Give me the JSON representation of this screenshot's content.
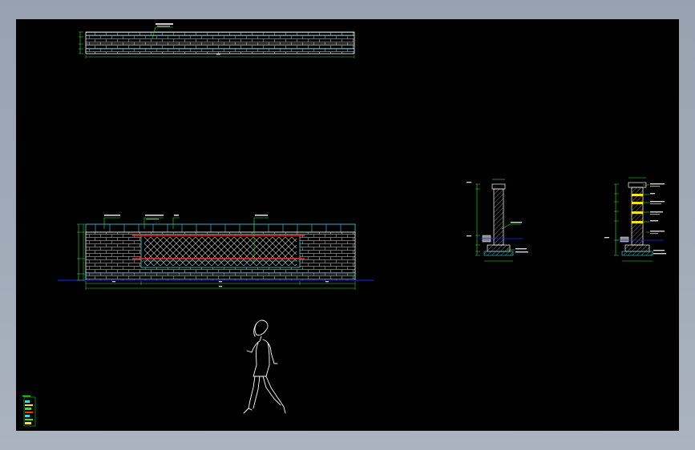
{
  "window": {
    "title": ""
  },
  "colors": {
    "background": "#000000",
    "frame": "#a3acb9",
    "wall_outline": "#ffffff",
    "brick_lines": "#8f8f8f",
    "dimension": "#2fe62f",
    "cyan": "#42d7e6",
    "red_band": "#ff2a2a",
    "yellow_band": "#ffe600",
    "ground_line": "#2020ff",
    "figure": "#ffffff"
  },
  "drawings": {
    "plan_view": {
      "name": "wall-plan-view"
    },
    "front_elevation": {
      "name": "wall-front-elevation",
      "panel": "lattice-panel"
    },
    "section_a": {
      "name": "wall-section-a"
    },
    "section_b": {
      "name": "wall-section-b"
    },
    "scale_figure": {
      "name": "scale-figure-woman"
    },
    "title_block": {
      "name": "mini-legend-block"
    }
  },
  "icons": [
    "crosshatch-pattern",
    "brick-pattern",
    "human-figure"
  ]
}
